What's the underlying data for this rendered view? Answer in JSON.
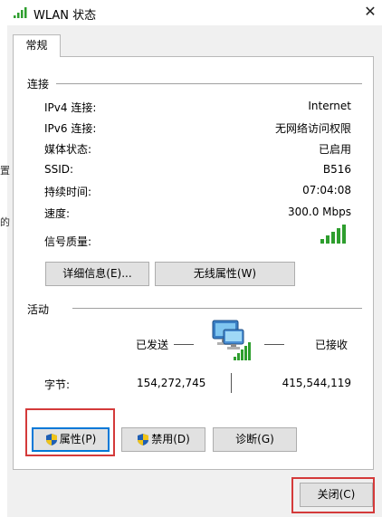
{
  "window": {
    "title": "WLAN 状态",
    "close_glyph": "✕"
  },
  "left_glyphs": [
    "置",
    "的"
  ],
  "tab": {
    "label": "常规"
  },
  "connection": {
    "section_label": "连接",
    "rows": [
      {
        "label": "IPv4 连接:",
        "value": "Internet"
      },
      {
        "label": "IPv6 连接:",
        "value": "无网络访问权限"
      },
      {
        "label": "媒体状态:",
        "value": "已启用"
      },
      {
        "label": "SSID:",
        "value": "B516"
      },
      {
        "label": "持续时间:",
        "value": "07:04:08"
      },
      {
        "label": "速度:",
        "value": "300.0 Mbps"
      },
      {
        "label": "信号质量:",
        "value": ""
      }
    ],
    "signal_bars": 5,
    "details_button": "详细信息(E)...",
    "wireless_props_button": "无线属性(W)"
  },
  "activity": {
    "section_label": "活动",
    "sent_label": "已发送",
    "received_label": "已接收",
    "bytes_label": "字节:",
    "bytes_sent": "154,272,745",
    "bytes_received": "415,544,119"
  },
  "buttons": {
    "properties": "属性(P)",
    "disable": "禁用(D)",
    "diagnose": "诊断(G)",
    "close": "关闭(C)"
  },
  "colors": {
    "signal_green": "#2e9e2e",
    "highlight_red": "#d43a3a",
    "focus_blue": "#0078d7"
  }
}
